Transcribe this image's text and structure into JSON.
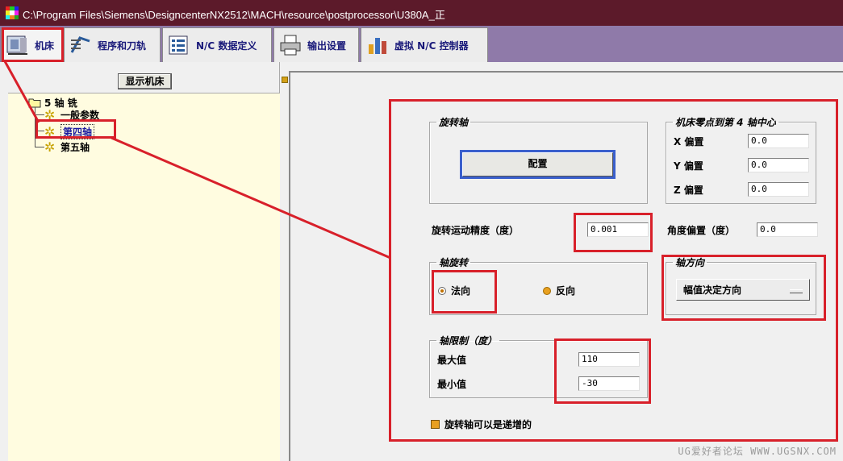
{
  "window": {
    "title": "C:\\Program Files\\Siemens\\DesigncenterNX2512\\MACH\\resource\\postprocessor\\U380A_正"
  },
  "tabs": [
    {
      "label": "机床",
      "icon": "machine-icon"
    },
    {
      "label": "程序和刀轨",
      "icon": "program-toolpath-icon"
    },
    {
      "label": "N/C 数据定义",
      "icon": "nc-data-icon"
    },
    {
      "label": "输出设置",
      "icon": "printer-icon"
    },
    {
      "label": "虚拟 N/C 控制器",
      "icon": "virtual-controller-icon"
    }
  ],
  "left": {
    "show_machine_label": "显示机床",
    "tree": {
      "root": "5 轴 铣",
      "items": [
        "一般参数",
        "第四轴",
        "第五轴"
      ],
      "selected": "第四轴"
    }
  },
  "rotary_axis": {
    "legend": "旋转轴",
    "config_button": "配置"
  },
  "zero_offset": {
    "legend": "机床零点到第 4 轴中心",
    "x_label": "X 偏置",
    "x_value": "0.0",
    "y_label": "Y 偏置",
    "y_value": "0.0",
    "z_label": "Z 偏置",
    "z_value": "0.0"
  },
  "resolution": {
    "label": "旋转运动精度（度）",
    "value": "0.001"
  },
  "angle_offset": {
    "label": "角度偏置（度）",
    "value": "0.0"
  },
  "axis_rotation": {
    "legend": "轴旋转",
    "normal_label": "法向",
    "reverse_label": "反向",
    "selected": "normal"
  },
  "axis_direction": {
    "legend": "轴方向",
    "option": "幅值决定方向"
  },
  "axis_limits": {
    "legend": "轴限制（度）",
    "max_label": "最大值",
    "max_value": "110",
    "min_label": "最小值",
    "min_value": "-30"
  },
  "incremental": {
    "label": "旋转轴可以是递增的",
    "checked": true
  },
  "watermark": "UG爱好者论坛 WWW.UGSNX.COM",
  "colors": {
    "title_bar": "#5c1a2a",
    "tab_strip": "#8f7aa9",
    "highlight": "#d8202a",
    "tree_bg": "#fffce0"
  }
}
